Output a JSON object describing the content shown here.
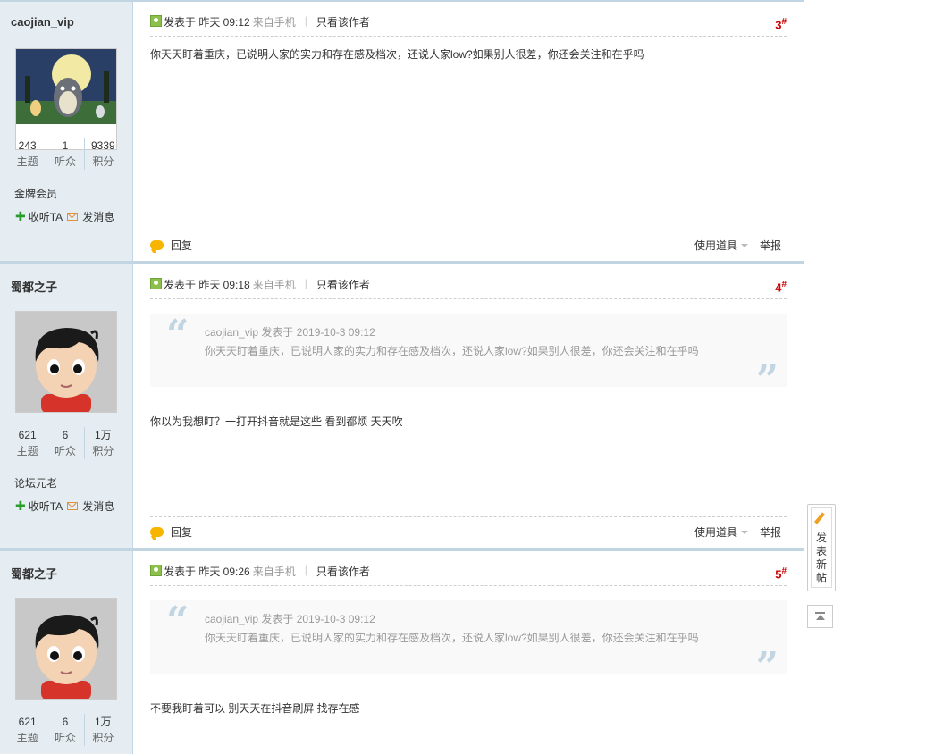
{
  "posts": [
    {
      "author": "caojian_vip",
      "avatar": "totoro-avatar",
      "stats": [
        {
          "num": "243",
          "label": "主题"
        },
        {
          "num": "1",
          "label": "听众"
        },
        {
          "num": "9339",
          "label": "积分"
        }
      ],
      "level": "金牌会员",
      "follow_label": "收听TA",
      "msg_label": "发消息",
      "time": "发表于 昨天 09:12",
      "from": "来自手机",
      "only_author": "只看该作者",
      "floor": "3",
      "content": "你天天盯着重庆，已说明人家的实力和存在感及档次，还说人家low?如果别人很差，你还会关注和在乎吗",
      "reply_label": "回复",
      "tools_label": "使用道具",
      "report_label": "举报"
    },
    {
      "author": "蜀都之子",
      "avatar": "cartoon-boy-avatar",
      "stats": [
        {
          "num": "621",
          "label": "主题"
        },
        {
          "num": "6",
          "label": "听众"
        },
        {
          "num": "1万",
          "label": "积分"
        }
      ],
      "level": "论坛元老",
      "follow_label": "收听TA",
      "msg_label": "发消息",
      "time": "发表于 昨天 09:18",
      "from": "来自手机",
      "only_author": "只看该作者",
      "floor": "4",
      "quote_head": "caojian_vip 发表于 2019-10-3 09:12",
      "quote_text": "你天天盯着重庆，已说明人家的实力和存在感及档次，还说人家low?如果别人很差，你还会关注和在乎吗",
      "content": "你以为我想盯？一打开抖音就是这些 看到都烦 天天吹",
      "reply_label": "回复",
      "tools_label": "使用道具",
      "report_label": "举报"
    },
    {
      "author": "蜀都之子",
      "avatar": "cartoon-boy-avatar",
      "stats": [
        {
          "num": "621",
          "label": "主题"
        },
        {
          "num": "6",
          "label": "听众"
        },
        {
          "num": "1万",
          "label": "积分"
        }
      ],
      "time": "发表于 昨天 09:26",
      "from": "来自手机",
      "only_author": "只看该作者",
      "floor": "5",
      "quote_head": "caojian_vip 发表于 2019-10-3 09:12",
      "quote_text": "你天天盯着重庆，已说明人家的实力和存在感及档次，还说人家low?如果别人很差，你还会关注和在乎吗",
      "content": "不要我盯着可以 别天天在抖音刷屏 找存在感"
    }
  ],
  "sidebar": {
    "newpost_label": "发表新帖",
    "totop_icon": "back-to-top-icon"
  },
  "colors": {
    "border": "#c2d5e3",
    "author_bg": "#e5edf2",
    "floor": "#cc0000"
  }
}
